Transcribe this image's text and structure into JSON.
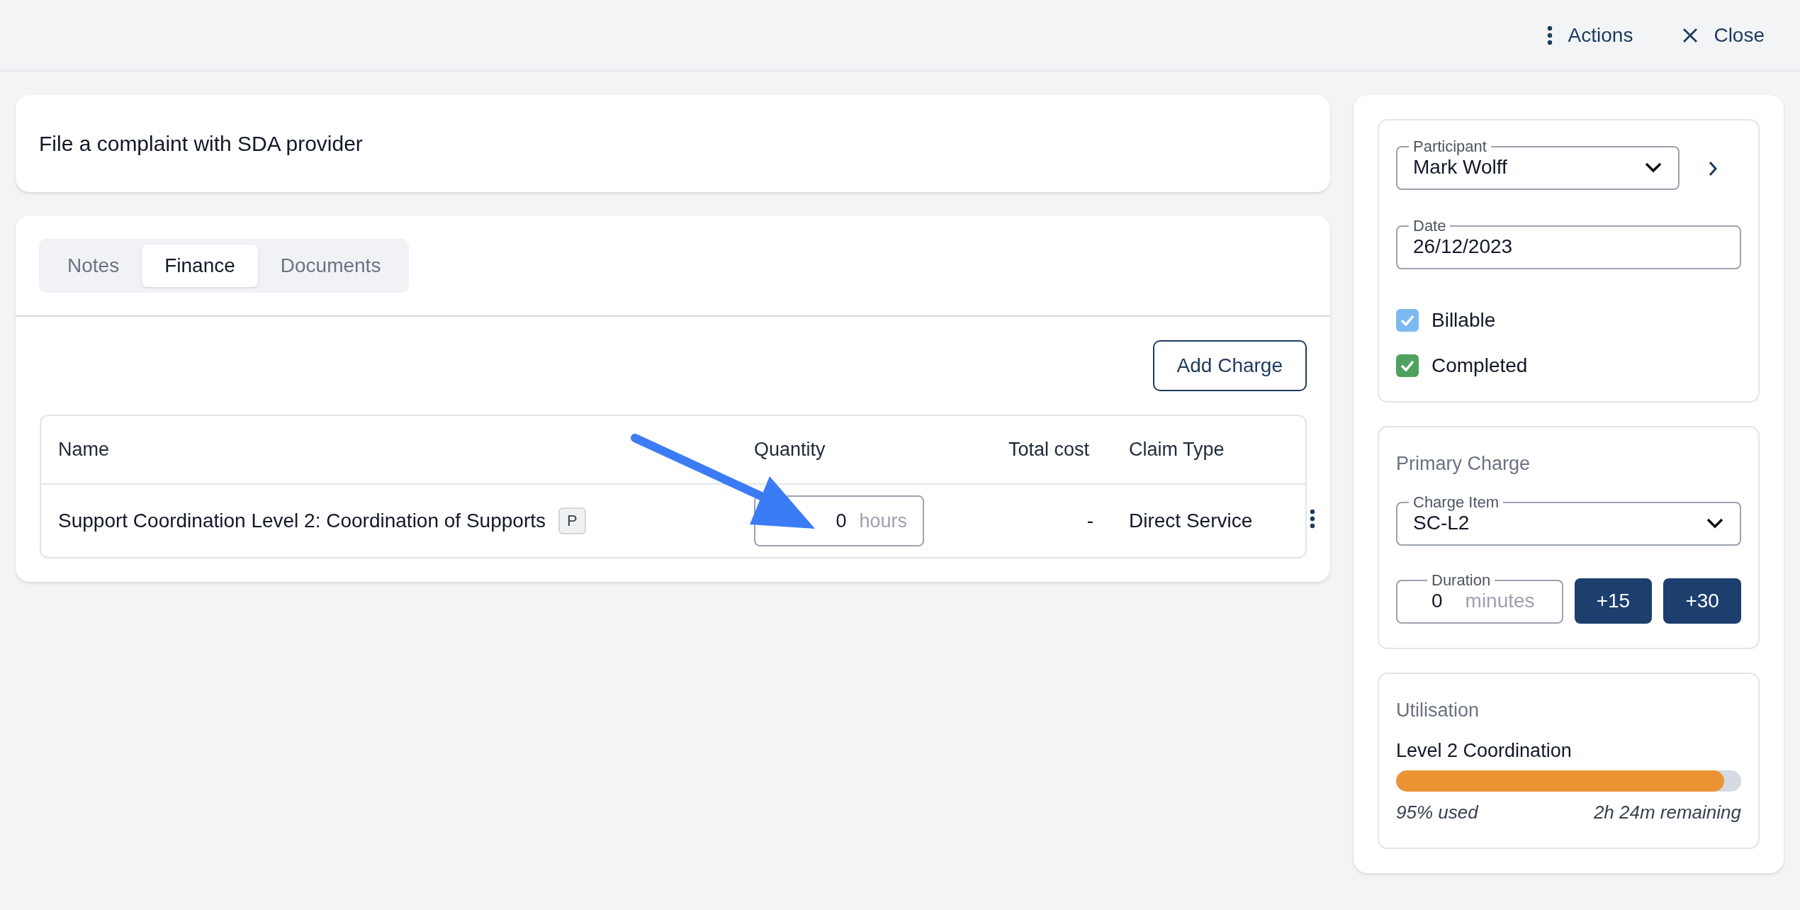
{
  "header": {
    "actions": [
      {
        "kind": "menu",
        "label": "Actions"
      },
      {
        "kind": "close",
        "label": "Close"
      }
    ]
  },
  "title": "File a complaint with SDA provider",
  "tabs": [
    {
      "label": "Notes",
      "selected": false
    },
    {
      "label": "Finance",
      "selected": true
    },
    {
      "label": "Documents",
      "selected": false
    }
  ],
  "add_charge": "Add Charge",
  "table": {
    "columns": [
      "Name",
      "Quantity",
      "Total cost",
      "Claim Type"
    ],
    "rows": [
      {
        "name": "Support Coordination Level 2: Coordination of Supports",
        "badge": "P",
        "quantity": "0",
        "unit": "hours",
        "total_cost": "-",
        "claim_type": "Direct Service"
      }
    ]
  },
  "details": {
    "participant": {
      "label": "Participant",
      "value": "Mark Wolff"
    },
    "date": {
      "label": "Date",
      "value": "26/12/2023"
    },
    "checkboxes": [
      {
        "label": "Billable",
        "checked": true,
        "color": "#7cb9f2"
      },
      {
        "label": "Completed",
        "checked": true,
        "color": "#4fa160"
      }
    ]
  },
  "primary_charge": {
    "heading": "Primary Charge",
    "charge_item": {
      "label": "Charge Item",
      "value": "SC-L2"
    },
    "duration": {
      "label": "Duration",
      "value": "0",
      "unit": "minutes"
    },
    "buttons": [
      "+15",
      "+30"
    ]
  },
  "utilisation": {
    "heading": "Utilisation",
    "name": "Level 2 Coordination",
    "level": 0.95,
    "used": "95% used",
    "remaining": "2h 24m remaining"
  }
}
